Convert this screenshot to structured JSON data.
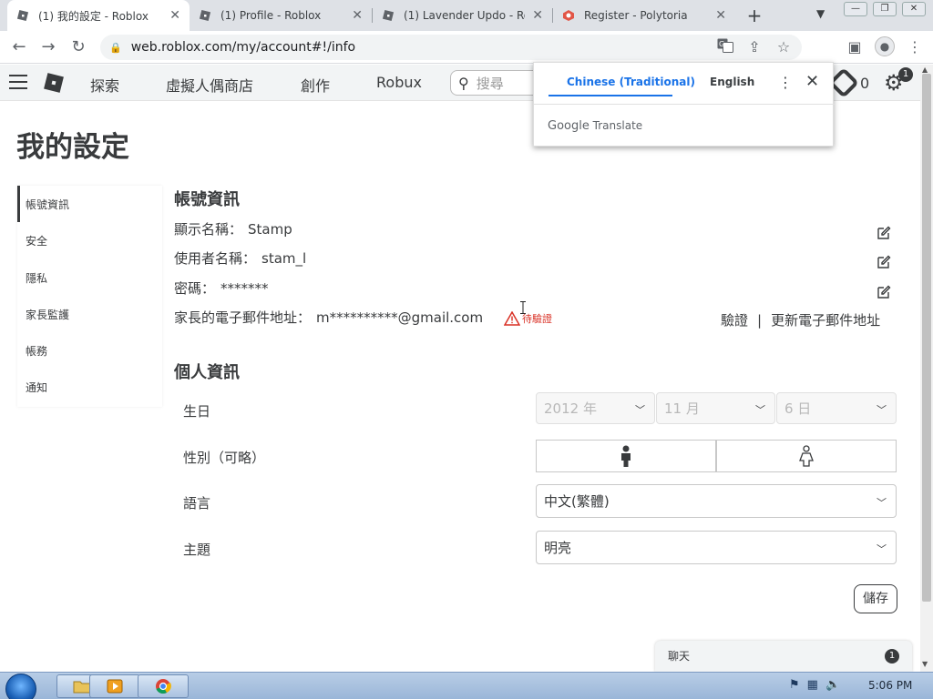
{
  "browser": {
    "tabs": [
      {
        "title": "(1) 我的設定 - Roblox",
        "active": true
      },
      {
        "title": "(1) Profile - Roblox",
        "active": false
      },
      {
        "title": "(1) Lavender Updo - Robl",
        "active": false
      },
      {
        "title": "Register - Polytoria",
        "active": false
      }
    ],
    "url": "web.roblox.com/my/account#!/info"
  },
  "header": {
    "nav": [
      "探索",
      "虛擬人偶商店",
      "創作",
      "Robux"
    ],
    "search_placeholder": "搜尋",
    "robux_balance": "0",
    "notification_count": "1"
  },
  "translate_popup": {
    "tab_active": "Chinese (Traditional)",
    "tab_other": "English",
    "brand_google": "Google",
    "brand_translate": "Translate"
  },
  "page": {
    "title": "我的設定",
    "sidebar": [
      "帳號資訊",
      "安全",
      "隱私",
      "家長監護",
      "帳務",
      "通知"
    ],
    "account_section": {
      "title": "帳號資訊",
      "display_name_label": "顯示名稱：",
      "display_name_value": "Stamp",
      "username_label": "使用者名稱：",
      "username_value": "stam_l",
      "password_label": "密碼：",
      "password_value": "*******",
      "parent_email_label": "家長的電子郵件地址：",
      "parent_email_value": "m**********@gmail.com",
      "pending_label": "待驗證",
      "verify_link": "驗證",
      "separator": "|",
      "update_email_link": "更新電子郵件地址"
    },
    "personal_section": {
      "title": "個人資訊",
      "birthday_label": "生日",
      "birth_year": "2012 年",
      "birth_month": "11 月",
      "birth_day": "6 日",
      "gender_label": "性別（可略）",
      "language_label": "語言",
      "language_value": "中文(繁體)",
      "theme_label": "主題",
      "theme_value": "明亮",
      "save_label": "儲存"
    },
    "chat": {
      "label": "聊天",
      "count": "1"
    }
  },
  "taskbar": {
    "time": "5:06 PM"
  },
  "colors": {
    "accent_blue": "#1a73e8",
    "warning_red": "#d93025",
    "text_dark": "#393b3d"
  }
}
